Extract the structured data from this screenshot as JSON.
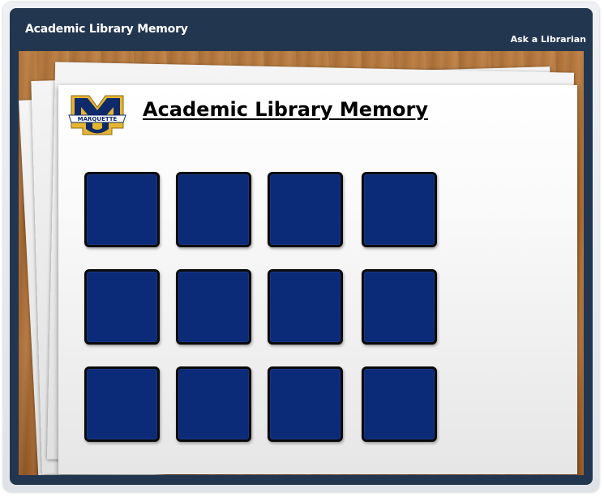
{
  "app": {
    "title": "Academic Library Memory",
    "ask_link": "Ask a Librarian"
  },
  "game": {
    "title": "Academic Library Memory",
    "logo_text": "MARQUETTE",
    "card_back_color": "#0b2b79",
    "rows": 3,
    "columns": 4,
    "cards": [
      {
        "id": 1
      },
      {
        "id": 2
      },
      {
        "id": 3
      },
      {
        "id": 4
      },
      {
        "id": 5
      },
      {
        "id": 6
      },
      {
        "id": 7
      },
      {
        "id": 8
      },
      {
        "id": 9
      },
      {
        "id": 10
      },
      {
        "id": 11
      },
      {
        "id": 12
      }
    ]
  },
  "colors": {
    "header": "#233650",
    "card_back": "#0b2b79",
    "logo_gold": "#e6b530",
    "logo_navy": "#0f2a6b"
  }
}
